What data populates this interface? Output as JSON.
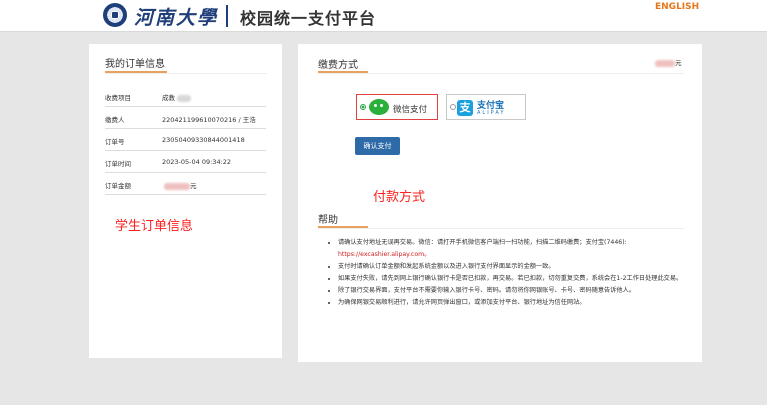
{
  "header": {
    "logo_text": "河南大學",
    "platform_title": "校园统一支付平台",
    "english_link": "ENGLISH"
  },
  "order_info": {
    "title": "我的订单信息",
    "rows": [
      {
        "label": "收费项目",
        "value": "成教"
      },
      {
        "label": "缴费人",
        "value": "220421199610070216 / 王浩"
      },
      {
        "label": "订单号",
        "value": "23050409330844001418"
      },
      {
        "label": "订单时间",
        "value": "2023-05-04 09:34:22"
      },
      {
        "label": "订单金额",
        "value": "元"
      }
    ]
  },
  "annotations": {
    "left": "学生订单信息",
    "right": "付款方式"
  },
  "payment": {
    "title": "缴费方式",
    "amount_unit": "元",
    "options": [
      {
        "label": "微信支付",
        "selected": true
      },
      {
        "label": "支付宝",
        "sub": "ALIPAY",
        "selected": false
      }
    ],
    "confirm_label": "确认支付"
  },
  "help": {
    "title": "帮助",
    "items": [
      {
        "text": "请确认支付地址无误再交易。微信：请打开手机微信客户端扫一扫功能，扫描二维码缴费；支付宝(7446):",
        "link": "https://excashier.alipay.com。"
      },
      {
        "text": "支付时请确认订单金额和发起系统金额以及进入银行支付界面显示的金额一致。"
      },
      {
        "text": "如果支付失败，请先到网上银行确认银行卡是否已扣款，再交易。若已扣款，切勿重复交费，系统会在1-2工作日处理此交易。"
      },
      {
        "text": "除了银行交易界面，支付平台不需要你输入银行卡号、密码。请勿将你网银账号、卡号、密码随意告诉他人。"
      },
      {
        "text": "为确保网银交易顺利进行，请允许网页弹出窗口，或添加支付平台、银行地址为信任网站。"
      }
    ]
  },
  "colors": {
    "brand_blue": "#1f3f7a",
    "accent_orange": "#e8761a",
    "annotation_red": "#ff2020",
    "button_blue": "#2e6aa8"
  }
}
